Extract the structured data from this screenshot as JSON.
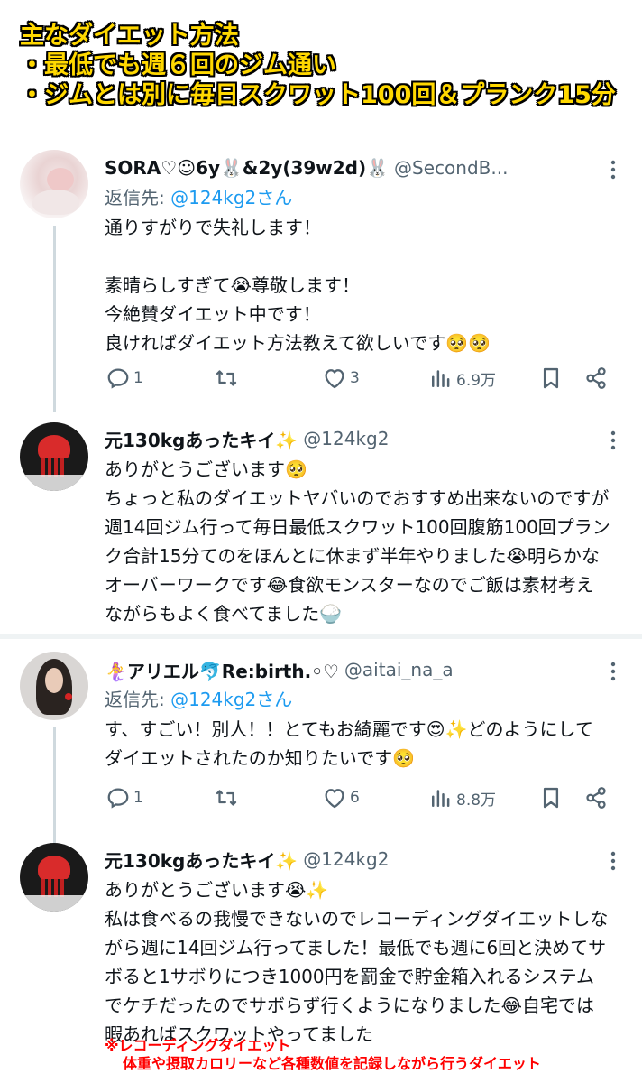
{
  "banner": {
    "line1": "主なダイエット方法",
    "line2": "・最低でも週６回のジム通い",
    "line3": "・ジムとは別に毎日スクワット100回＆プランク15分"
  },
  "tweets": [
    {
      "display_name": "SORA♡☺6y🐰&2y(39w2d)🐰",
      "handle": "@SecondB...",
      "reply_prefix": "返信先: ",
      "reply_mention": "@124kg2さん",
      "text": "通りすがりで失礼します！\n\n素晴らしすぎて😭尊敬します！\n今絶賛ダイエット中です！\n良ければダイエット方法教えて欲しいです🥺🥺",
      "replies": "1",
      "retweets": "",
      "likes": "3",
      "views": "6.9万"
    },
    {
      "display_name": "元130kgあったキイ✨",
      "handle": "@124kg2",
      "text": "ありがとうございます🥺\nちょっと私のダイエットヤバいのでおすすめ出来ないのですが\n週14回ジム行って毎日最低スクワット100回腹筋100回プラン\nク合計15分てのをほんとに休まず半年やりました😭明らかな\nオーバーワークです😂食欲モンスターなのでご飯は素材考え\nながらもよく食べてました🍚"
    },
    {
      "display_name": "🧜‍♀️アリエル🐬Re:birth.◦♡",
      "handle": "@aitai_na_a",
      "reply_prefix": "返信先: ",
      "reply_mention": "@124kg2さん",
      "text": "す、すごい！別人！！とてもお綺麗です😍✨どのようにして\nダイエットされたのか知りたいです🥺",
      "replies": "1",
      "retweets": "",
      "likes": "6",
      "views": "8.8万"
    },
    {
      "display_name": "元130kgあったキイ✨",
      "handle": "@124kg2",
      "text": "ありがとうございます😭✨\n私は食べるの我慢できないのでレコーディングダイエットしな\nがら週に14回ジム行ってました！最低でも週に6回と決めてサ\nボると1サボりにつき1000円を罰金で貯金箱入れるシステム\nでケチだったのでサボらず行くようになりました😂自宅では\n暇あればスクワットやってました"
    }
  ],
  "footnote": {
    "line1": "※レコーディングダイエット",
    "line2": "体重や摂取カロリーなど各種数値を記録しながら行うダイエット"
  },
  "colors": {
    "banner_text": "#ffd800",
    "link": "#1d9bf0",
    "secondary": "#536471",
    "footnote": "#ff0000"
  }
}
